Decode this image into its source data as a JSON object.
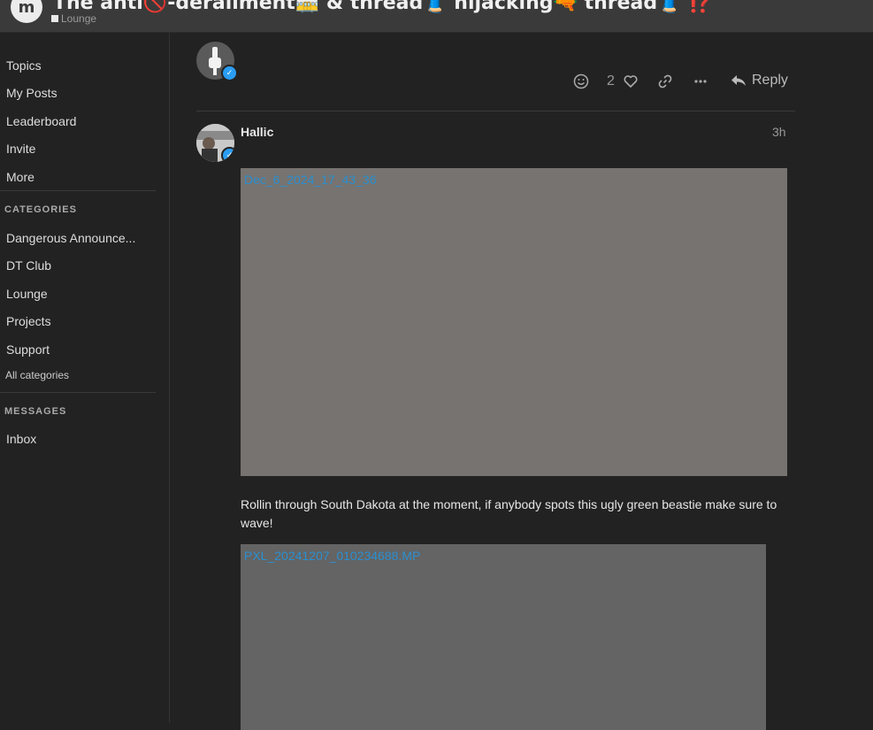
{
  "header": {
    "logo_text": "m",
    "title": "The anti🚫-derailment🚋 & thread🧵 hijacking🔫 thread🧵 ⁉️",
    "category": "Lounge"
  },
  "sidebar": {
    "nav": [
      "Topics",
      "My Posts",
      "Leaderboard",
      "Invite",
      "More"
    ],
    "categories_heading": "CATEGORIES",
    "categories": [
      "Dangerous Announce...",
      "DT Club",
      "Lounge",
      "Projects",
      "Support"
    ],
    "all_categories": "All categories",
    "messages_heading": "MESSAGES",
    "messages": [
      "Inbox"
    ]
  },
  "prev_post": {
    "like_count": "2",
    "reply_label": "Reply"
  },
  "post": {
    "username": "Hallic",
    "time": "3h",
    "image1_link": "Dec_6_2024_17_43_36",
    "text": "Rollin through South Dakota at the moment, if anybody spots this ugly green beastie make sure to wave!",
    "image2_link": "PXL_20241207_010234688.MP"
  },
  "colors": {
    "accent": "#2a9df4",
    "link": "#2a8fd0",
    "background": "#222222",
    "header": "#3a3a3a"
  }
}
